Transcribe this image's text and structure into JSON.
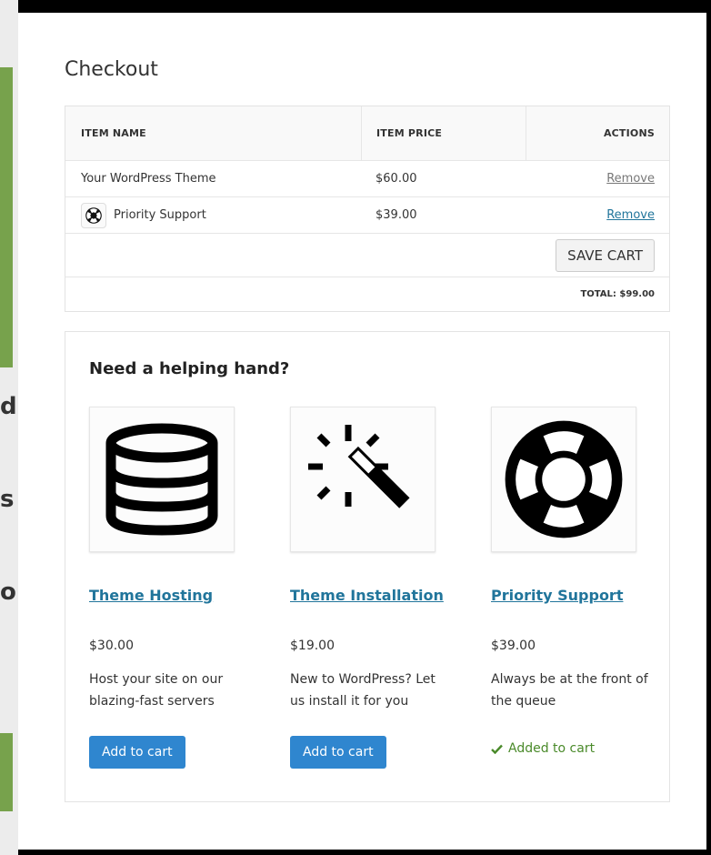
{
  "checkout": {
    "title": "Checkout",
    "columns": {
      "item_name": "ITEM NAME",
      "item_price": "ITEM PRICE",
      "actions": "ACTIONS"
    },
    "items": [
      {
        "name": "Your WordPress Theme",
        "price": "$60.00",
        "action": "Remove",
        "icon": ""
      },
      {
        "name": "Priority Support",
        "price": "$39.00",
        "action": "Remove",
        "icon": "lifebuoy-icon"
      }
    ],
    "save_label": "SAVE CART",
    "total_label": "TOTAL: $99.00"
  },
  "help": {
    "title": "Need a helping hand?",
    "products": [
      {
        "name": "Theme Hosting",
        "price": "$30.00",
        "description": "Host your site on our blazing-fast servers",
        "button": "Add to cart",
        "icon": "database-icon"
      },
      {
        "name": "Theme Installation",
        "price": "$19.00",
        "description": "New to WordPress? Let us install it for you",
        "button": "Add to cart",
        "icon": "magic-wand-icon"
      },
      {
        "name": "Priority Support",
        "price": "$39.00",
        "description": "Always be at the front of the queue",
        "added": "Added to cart",
        "icon": "lifebuoy-icon"
      }
    ]
  },
  "colors": {
    "link": "#21759b",
    "button": "#2f86cf",
    "added": "#4a8a2a"
  }
}
